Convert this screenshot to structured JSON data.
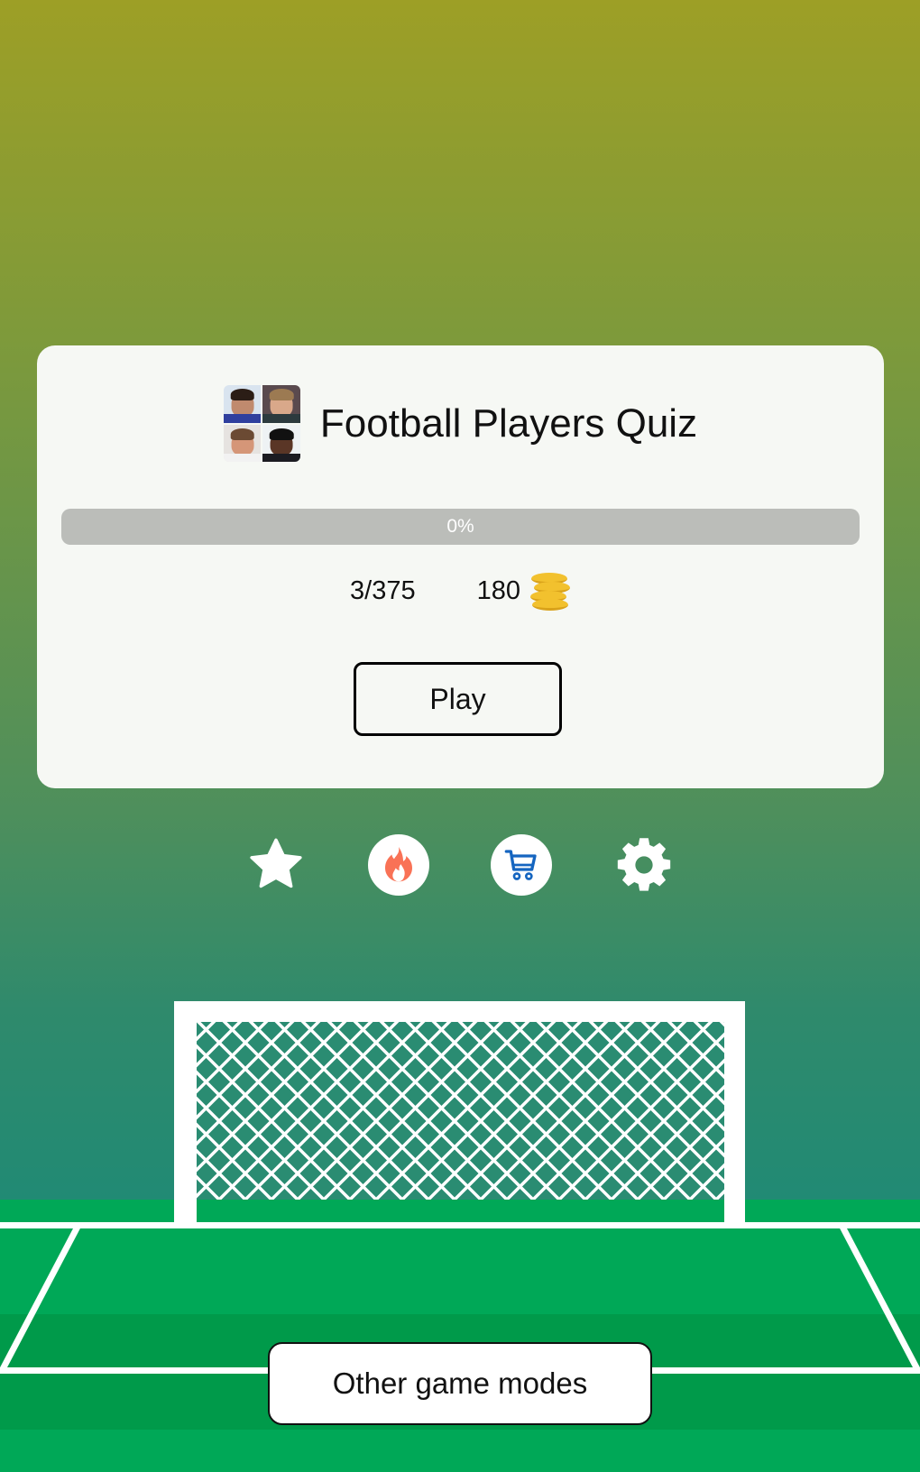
{
  "quiz": {
    "title": "Football Players Quiz",
    "logo_icon": "player-faces-collage-icon",
    "progress_percent": 0,
    "progress_label": "0%",
    "answered_count": "3/375",
    "coins": "180",
    "coins_icon": "coin-stack-icon",
    "play_label": "Play"
  },
  "toolbar": {
    "items": [
      {
        "name": "favorites",
        "icon": "star-icon"
      },
      {
        "name": "hot",
        "icon": "fire-icon"
      },
      {
        "name": "shop",
        "icon": "cart-icon"
      },
      {
        "name": "settings",
        "icon": "gear-icon"
      }
    ]
  },
  "footer": {
    "other_modes_label": "Other game modes"
  },
  "colors": {
    "card_bg": "#f6f8f4",
    "progress_track": "#bbbdb9",
    "fire": "#f97256",
    "cart": "#1565c0",
    "grass": "#00a857",
    "grass_band": "#009a4a"
  }
}
